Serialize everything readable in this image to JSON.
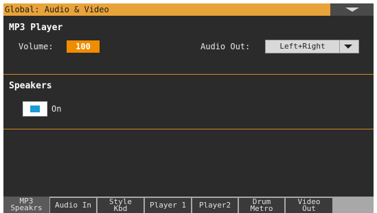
{
  "header": {
    "title": "Global: Audio & Video",
    "menu_icon": "chevron-down-icon"
  },
  "mp3_player": {
    "section_title": "MP3 Player",
    "volume_label": "Volume:",
    "volume_value": "100",
    "audio_out_label": "Audio Out:",
    "audio_out_value": "Left+Right"
  },
  "speakers": {
    "section_title": "Speakers",
    "checkbox_label": "On",
    "checked": true
  },
  "tabs": [
    {
      "label": "MP3\nSpeakrs",
      "active": true
    },
    {
      "label": "Audio In",
      "active": false
    },
    {
      "label": "Style\nKbd",
      "active": false
    },
    {
      "label": "Player 1",
      "active": false
    },
    {
      "label": "Player2",
      "active": false
    },
    {
      "label": "Drum\nMetro",
      "active": false
    },
    {
      "label": "Video\nOut",
      "active": false
    }
  ],
  "colors": {
    "accent": "#e8a33a",
    "value_field": "#f08c00",
    "checkbox_fill": "#1a9cd8",
    "divider": "#d98a1f"
  }
}
